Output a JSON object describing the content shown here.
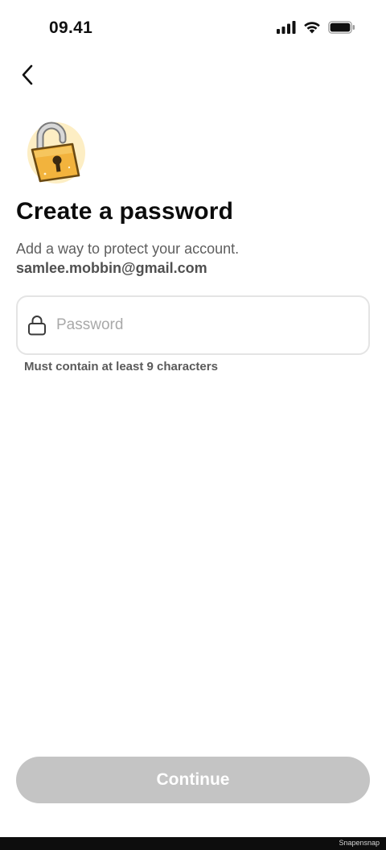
{
  "status_bar": {
    "time": "09.41",
    "icons": [
      "signal-icon",
      "wifi-icon",
      "battery-icon"
    ]
  },
  "nav": {
    "back_icon": "chevron-left-icon"
  },
  "illustration": {
    "name": "padlock-illustration",
    "colors": {
      "body": "#f2b33d",
      "shackle": "#cfcfcf",
      "glow": "#fdeec4"
    }
  },
  "header": {
    "title": "Create a password",
    "subtitle": "Add a way to protect your account.",
    "email": "samlee.mobbin@gmail.com"
  },
  "form": {
    "password": {
      "icon": "lock-icon",
      "placeholder": "Password",
      "value": ""
    },
    "hint": "Must contain at least 9 characters"
  },
  "actions": {
    "continue_label": "Continue",
    "continue_color": "#c4c4c4"
  },
  "footer": {
    "watermark": "Snapensnap"
  }
}
